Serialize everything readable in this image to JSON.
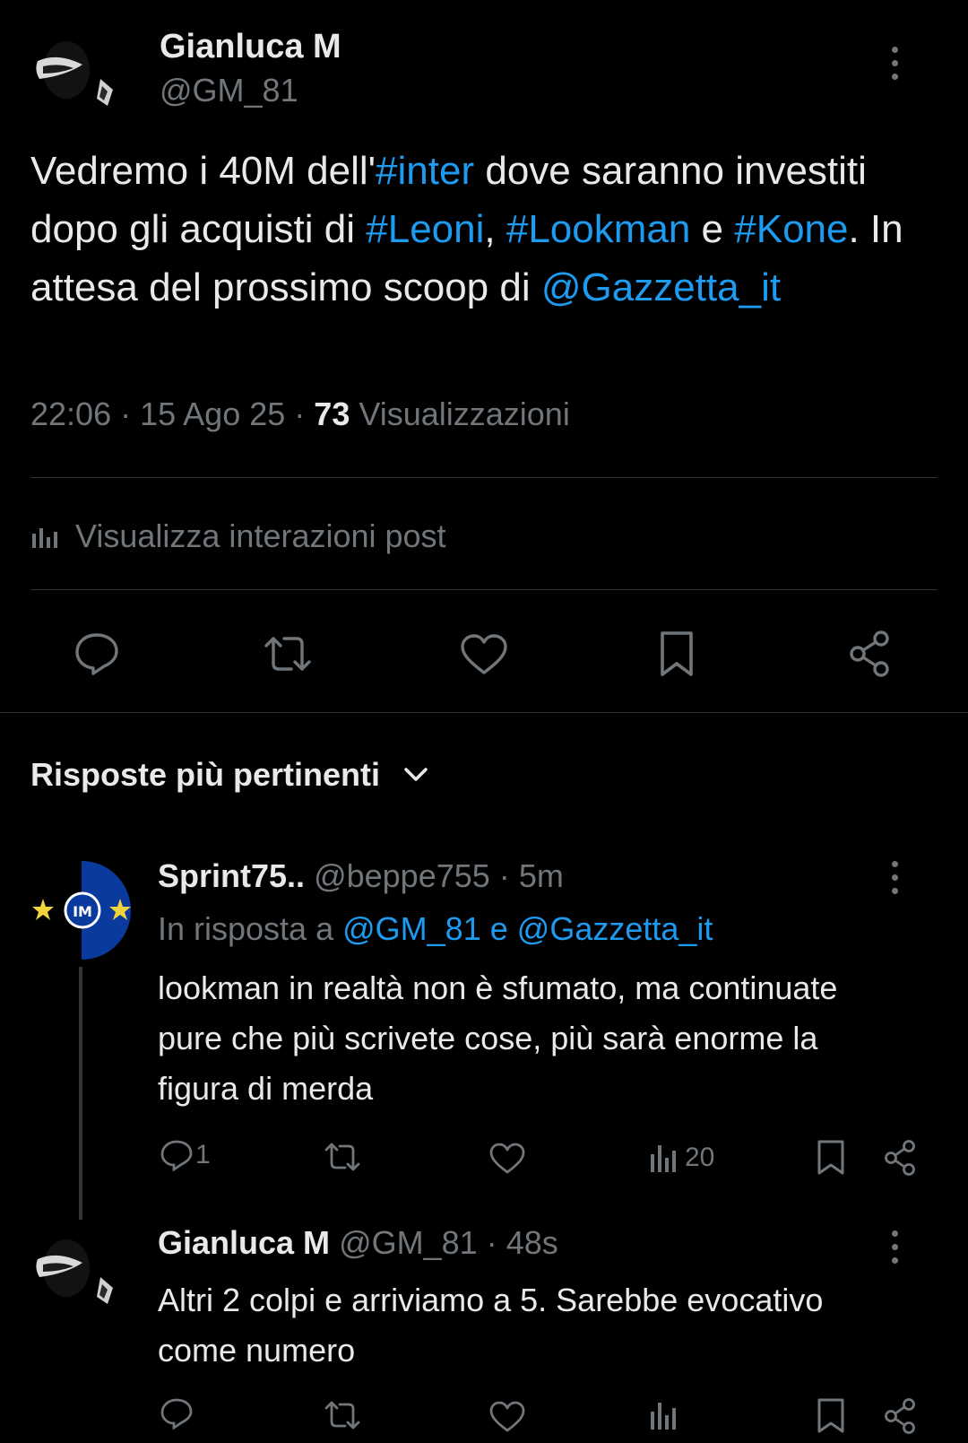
{
  "main_post": {
    "author_name": "Gianluca M",
    "author_handle": "@GM_81",
    "text_parts": [
      {
        "text": "Vedremo i 40M dell'",
        "link": false
      },
      {
        "text": "#inter",
        "link": true
      },
      {
        "text": " dove saranno investiti dopo gli acquisti di ",
        "link": false
      },
      {
        "text": "#Leoni",
        "link": true
      },
      {
        "text": ", ",
        "link": false
      },
      {
        "text": "#Lookman",
        "link": true
      },
      {
        "text": " e ",
        "link": false
      },
      {
        "text": "#Kone",
        "link": true
      },
      {
        "text": ". In attesa del prossimo scoop di ",
        "link": false
      },
      {
        "text": "@Gazzetta_it",
        "link": true
      }
    ],
    "time": "22:06",
    "date": "15 Ago 25",
    "views_count": "73",
    "views_label": "Visualizzazioni",
    "interactions_link": "Visualizza interazioni post"
  },
  "replies_header": "Risposte più pertinenti",
  "replies": [
    {
      "author_name": "Sprint75..",
      "author_handle": "@beppe755",
      "age": "5m",
      "reply_to_prefix": "In risposta a",
      "reply_to_1": "@GM_81",
      "reply_to_and": "e",
      "reply_to_2": "@Gazzetta_it",
      "text": "lookman in realtà non è sfumato, ma continuate pure che più scrivete cose, più sarà enorme la figura di merda",
      "reply_count": "1",
      "views_count": "20"
    },
    {
      "author_name": "Gianluca M",
      "author_handle": "@GM_81",
      "age": "48s",
      "text": "Altri 2 colpi e arriviamo a 5. Sarebbe evocativo come numero"
    }
  ],
  "colors": {
    "background": "#000000",
    "text": "#e7e9ea",
    "muted": "#71767b",
    "link": "#1d9bf0",
    "divider": "#2f3336"
  },
  "icons": [
    "reply-icon",
    "repost-icon",
    "like-icon",
    "bookmark-icon",
    "share-icon",
    "analytics-icon",
    "more-icon",
    "chevron-down-icon"
  ]
}
